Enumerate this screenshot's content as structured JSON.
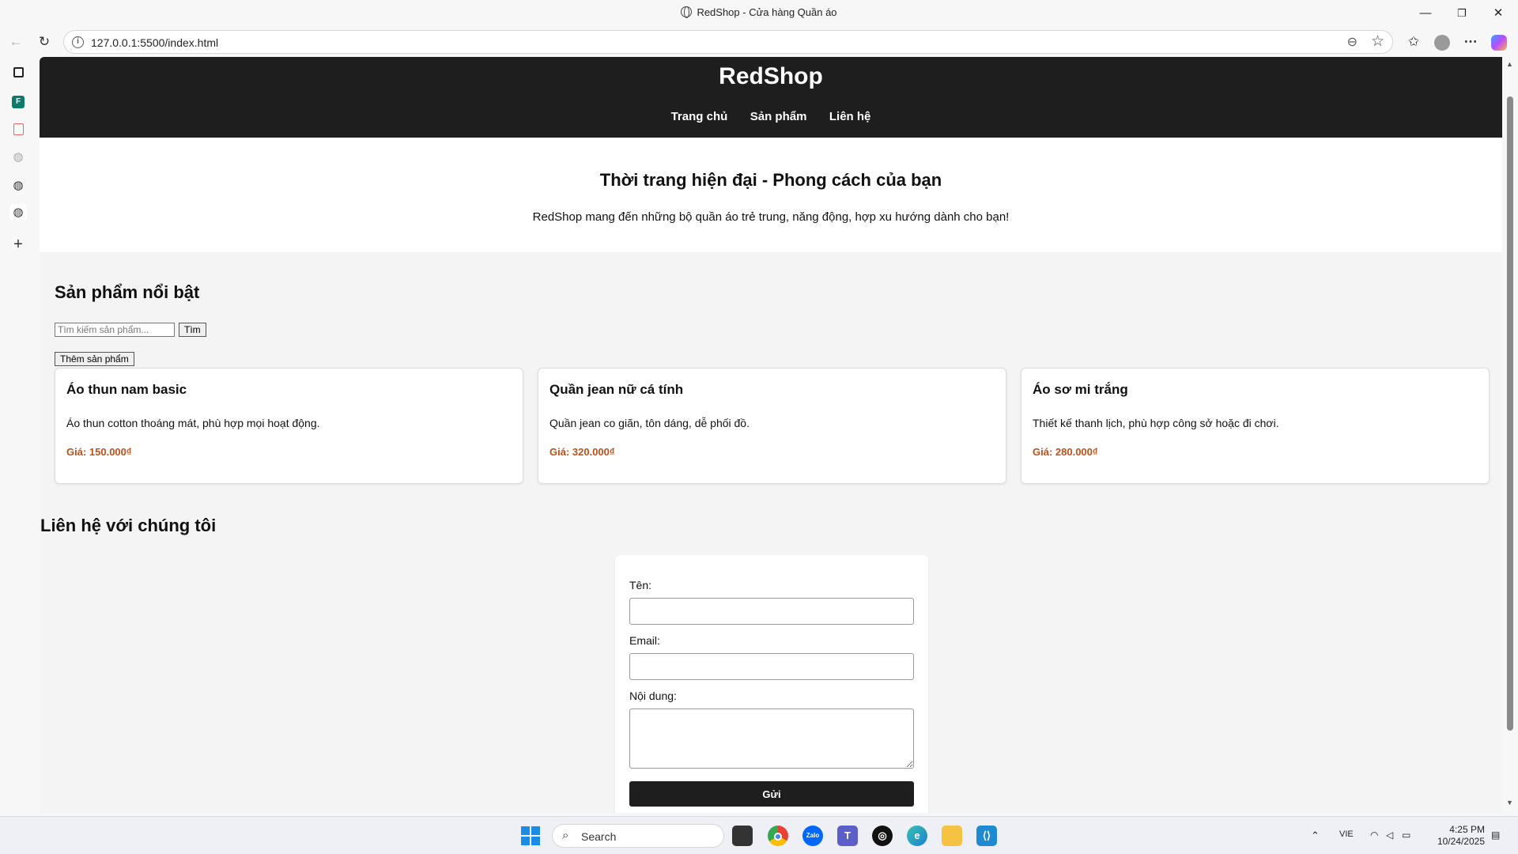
{
  "window": {
    "title": "RedShop - Cửa hàng Quần áo",
    "minimize": "—",
    "restore": "❐",
    "close": "✕"
  },
  "browser": {
    "url": "127.0.0.1:5500/index.html"
  },
  "site": {
    "logo": "RedShop",
    "nav": [
      "Trang chủ",
      "Sản phẩm",
      "Liên hệ"
    ]
  },
  "hero": {
    "title": "Thời trang hiện đại - Phong cách của bạn",
    "subtitle": "RedShop mang đến những bộ quần áo trẻ trung, năng động, hợp xu hướng dành cho bạn!"
  },
  "products": {
    "title": "Sản phẩm nổi bật",
    "search_placeholder": "Tìm kiếm sản phẩm...",
    "search_button": "Tìm",
    "add_button": "Thêm sản phẩm",
    "price_color": "#c0501a",
    "items": [
      {
        "name": "Áo thun nam basic",
        "desc": "Áo thun cotton thoáng mát, phù hợp mọi hoạt động.",
        "price": "Giá: 150.000₫"
      },
      {
        "name": "Quần jean nữ cá tính",
        "desc": "Quần jean co giãn, tôn dáng, dễ phối đồ.",
        "price": "Giá: 320.000₫"
      },
      {
        "name": "Áo sơ mi trắng",
        "desc": "Thiết kế thanh lịch, phù hợp công sở hoặc đi chơi.",
        "price": "Giá: 280.000₫"
      }
    ]
  },
  "contact": {
    "title": "Liên hệ với chúng tôi",
    "name_label": "Tên:",
    "email_label": "Email:",
    "message_label": "Nội dung:",
    "submit": "Gửi"
  },
  "taskbar": {
    "search": "Search",
    "language": "VIE",
    "time": "4:25 PM",
    "date": "10/24/2025"
  }
}
